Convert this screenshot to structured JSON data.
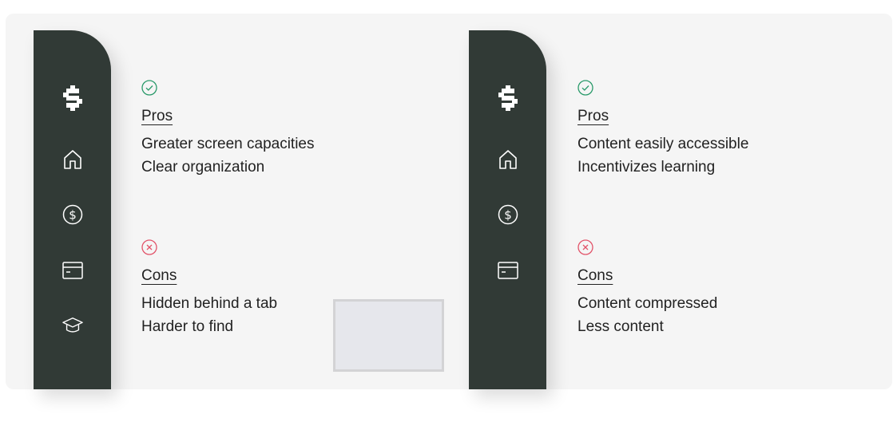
{
  "colors": {
    "card_bg": "#f5f5f5",
    "sidebar_bg": "#313a36",
    "pro_green": "#2a9a6a",
    "con_red": "#e2546a",
    "text": "#222222",
    "placeholder_bg": "#e6e7ec"
  },
  "left_panel": {
    "nav_icons": [
      "brand-dollar-icon",
      "home-icon",
      "dollar-circle-icon",
      "credit-card-icon",
      "graduation-cap-icon"
    ],
    "pros": {
      "icon": "check-circle-icon",
      "heading": "Pros",
      "items": [
        "Greater screen capacities",
        "Clear organization"
      ]
    },
    "cons": {
      "icon": "x-circle-icon",
      "heading": "Cons",
      "items": [
        "Hidden behind a tab",
        "Harder to find"
      ]
    }
  },
  "right_panel": {
    "nav_icons": [
      "brand-dollar-icon",
      "home-icon",
      "dollar-circle-icon",
      "credit-card-icon"
    ],
    "pros": {
      "icon": "check-circle-icon",
      "heading": "Pros",
      "items": [
        "Content easily accessible",
        "Incentivizes learning"
      ]
    },
    "cons": {
      "icon": "x-circle-icon",
      "heading": "Cons",
      "items": [
        "Content compressed",
        "Less content"
      ]
    }
  }
}
